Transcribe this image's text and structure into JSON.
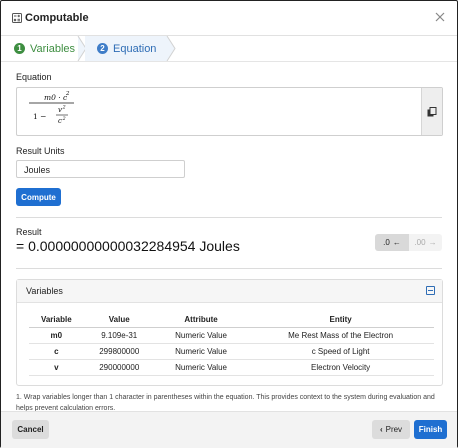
{
  "header": {
    "title": "Computable",
    "icons": {
      "app": "calculator-icon",
      "close": "close-icon"
    }
  },
  "steps": [
    {
      "num": "1",
      "label": "Variables",
      "color": "#3e8e41"
    },
    {
      "num": "2",
      "label": "Equation",
      "color": "#2f6db5"
    }
  ],
  "equation": {
    "label": "Equation",
    "numerator": "m0 · c",
    "numerator_exp": "2",
    "denominator_prefix": "1 −",
    "inner_numerator": "v",
    "inner_numerator_exp": "2",
    "inner_denominator": "c",
    "inner_denominator_exp": "2",
    "copy_icon": "copy-icon"
  },
  "units": {
    "label": "Result Units",
    "value": "Joules"
  },
  "compute_label": "Compute",
  "result": {
    "label": "Result",
    "text": "= 0.00000000000032284954 Joules",
    "toggle_left": ".0",
    "toggle_right": ".00"
  },
  "variables": {
    "title": "Variables",
    "columns": [
      "Variable",
      "Value",
      "Attribute",
      "Entity"
    ],
    "rows": [
      {
        "variable": "m0",
        "value": "9.109e-31",
        "attribute": "Numeric Value",
        "entity": "Me Rest Mass of the Electron"
      },
      {
        "variable": "c",
        "value": "299800000",
        "attribute": "Numeric Value",
        "entity": "c Speed of Light"
      },
      {
        "variable": "v",
        "value": "290000000",
        "attribute": "Numeric Value",
        "entity": "Electron Velocity"
      }
    ]
  },
  "note": "1. Wrap variables longer than 1 character in parentheses within the equation. This provides context to the system during evaluation and helps prevent calculation errors.",
  "footer": {
    "cancel": "Cancel",
    "prev": "Prev",
    "finish": "Finish"
  },
  "colors": {
    "primary": "#1f6fd1",
    "step_done": "#3e8e41",
    "step_active": "#2f6db5"
  }
}
